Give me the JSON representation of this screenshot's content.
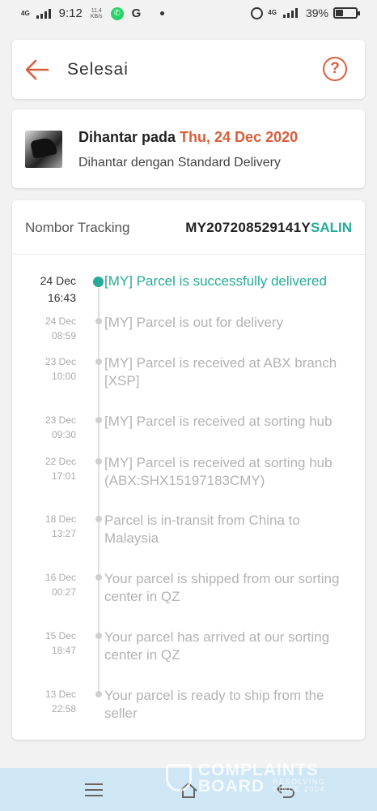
{
  "status_bar": {
    "network": "4G",
    "time": "9:12",
    "speed_value": "11.4",
    "speed_unit": "KB/s",
    "google_icon": "G",
    "right_network": "4G",
    "battery_percent": "39%",
    "battery_level": 0.39
  },
  "header": {
    "title": "Selesai",
    "help_icon": "?",
    "accent_color": "#d95e3b"
  },
  "delivery": {
    "label": "Dihantar pada",
    "date": "Thu, 24 Dec 2020",
    "method": "Dihantar dengan Standard Delivery"
  },
  "tracking": {
    "label": "Nombor Tracking",
    "number": "MY207208529141Y",
    "copy_label": "SALIN",
    "active_color": "#26aa99",
    "events": [
      {
        "day": "24 Dec",
        "time": "16:43",
        "desc": "[MY] Parcel is successfully delivered",
        "active": true
      },
      {
        "day": "24 Dec",
        "time": "08:59",
        "desc": "[MY] Parcel is out for delivery",
        "active": false
      },
      {
        "day": "23 Dec",
        "time": "10:00",
        "desc": "[MY] Parcel is received at ABX branch [XSP]",
        "active": false
      },
      {
        "day": "23 Dec",
        "time": "09:30",
        "desc": "[MY] Parcel is received at sorting hub",
        "active": false
      },
      {
        "day": "22 Dec",
        "time": "17:01",
        "desc": "[MY] Parcel is received at sorting hub (ABX:SHX15197183CMY)",
        "active": false
      },
      {
        "day": "18 Dec",
        "time": "13:27",
        "desc": "Parcel is in-transit from China to Malaysia",
        "active": false
      },
      {
        "day": "16 Dec",
        "time": "00:27",
        "desc": "Your parcel is shipped from our sorting center in QZ",
        "active": false
      },
      {
        "day": "15 Dec",
        "time": "18:47",
        "desc": "Your parcel has arrived at our sorting center in QZ",
        "active": false
      },
      {
        "day": "13 Dec",
        "time": "22:58",
        "desc": "Your parcel is ready to ship from the seller",
        "active": false
      }
    ]
  },
  "watermark": {
    "line1": "COMPLAINTS",
    "line2": "BOARD",
    "tag1": "RESOLVING",
    "tag2": "SINCE 2004"
  }
}
